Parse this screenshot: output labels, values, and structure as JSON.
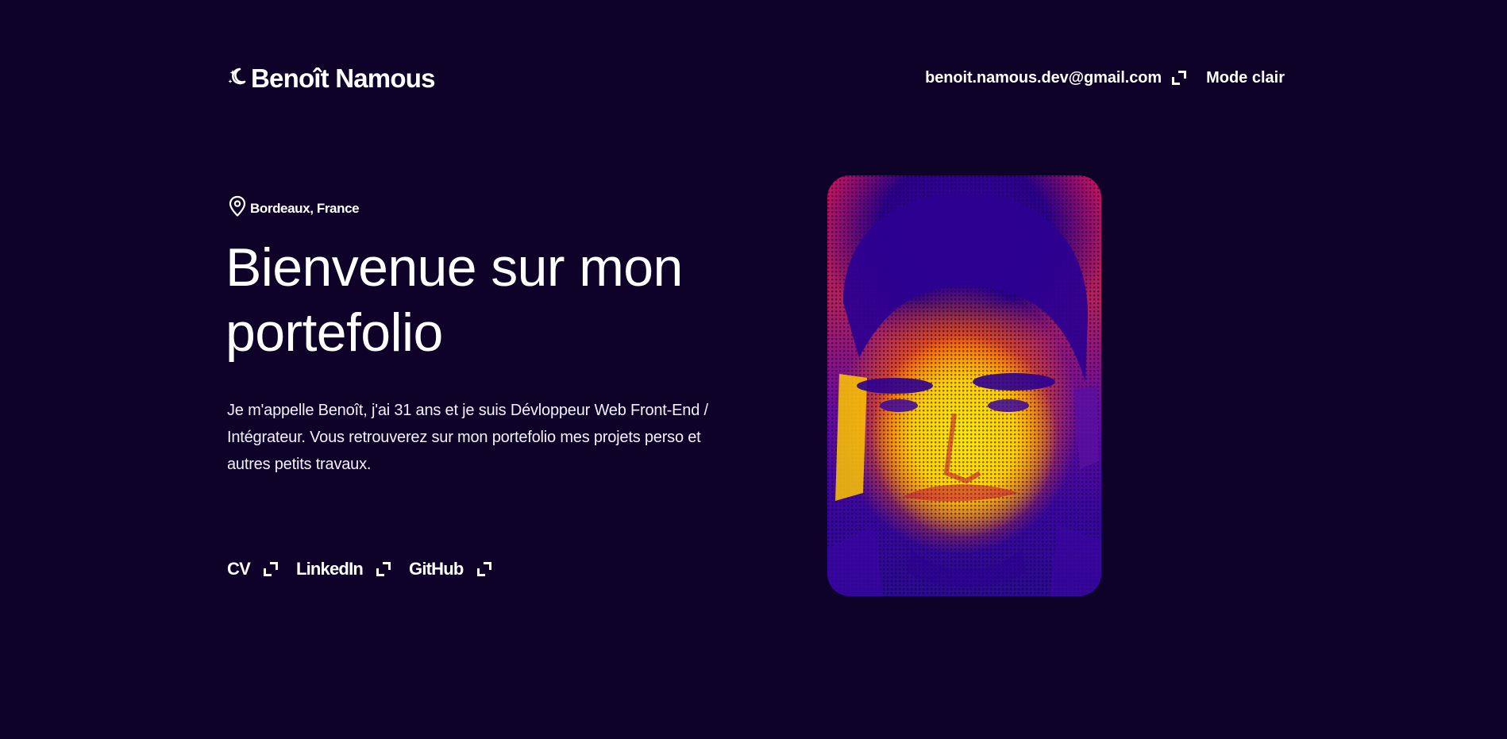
{
  "header": {
    "brand_name": "Benoît Namous",
    "brand_icon": "moon-stars-icon",
    "email": "benoit.namous.dev@gmail.com",
    "mode_toggle": "Mode clair"
  },
  "hero": {
    "location": "Bordeaux, France",
    "location_icon": "map-pin-icon",
    "title_line1": "Bienvenue sur mon",
    "title_line2": "portefolio",
    "description_line1": "Je m'appelle Benoît, j'ai 31 ans et je suis Dévloppeur Web Front-End /",
    "description_line2": "Intégrateur. Vous retrouverez sur mon portefolio mes projets perso et",
    "description_line3": "autres petits travaux."
  },
  "social_links": [
    {
      "label": "CV",
      "icon": "external-link-icon"
    },
    {
      "label": "LinkedIn",
      "icon": "external-link-icon"
    },
    {
      "label": "GitHub",
      "icon": "external-link-icon"
    }
  ],
  "colors": {
    "background": "#0e0228",
    "text": "#ffffff",
    "portrait_primary": "#ffd000",
    "portrait_secondary": "#3a06a0",
    "portrait_accent": "#c01060"
  }
}
